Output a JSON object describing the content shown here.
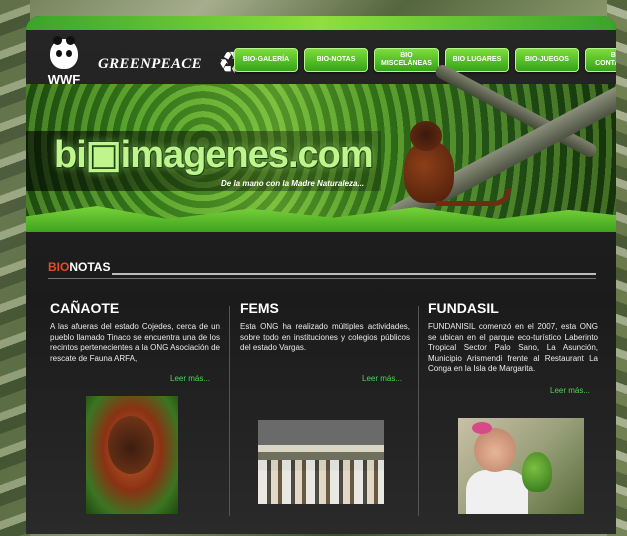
{
  "brand": {
    "wwf_label": "WWF",
    "greenpeace_label": "GREENPEACE",
    "recycle_icon": "recycle-icon",
    "site_logo": "bi▣imagenes.com",
    "tagline": "De la mano con la  Madre Naturaleza..."
  },
  "nav": {
    "items": [
      {
        "label": "BIO-GALERÍA"
      },
      {
        "label": "BIO-NOTAS"
      },
      {
        "label": "BIO MISCELÁNEAS"
      },
      {
        "label": "BIO LUGARES"
      },
      {
        "label": "BIO-JUEGOS"
      },
      {
        "label": "BIO CONTACTOS"
      }
    ]
  },
  "section": {
    "prefix": "BIO",
    "suffix": "NOTAS"
  },
  "articles": [
    {
      "title": "CAÑAOTE",
      "body": "A las afueras del estado Cojedes, cerca de un pueblo llamado Tinaco se encuentra una de los recintos pertenecientes a la ONG Asociación de rescate de Fauna ARFA,",
      "more": "Leer más..."
    },
    {
      "title": "FEMS",
      "body": "Esta ONG ha realizado múltiples actividades, sobre todo en instituciones y colegios públicos del estado Vargas.",
      "more": "Leer más..."
    },
    {
      "title": "FUNDASIL",
      "body": "FUNDANISIL comenzó en el 2007, esta ONG se ubican en el parque eco-turístico Laberinto Tropical Sector Palo Sano, La Asunción, Municipio Arismendi frente al Restaurant La Conga en la Isla de Margarita.",
      "more": "Leer más..."
    }
  ],
  "colors": {
    "accent_green": "#4ed45a",
    "nav_green": "#34a317",
    "bio_red": "#e84a27"
  }
}
